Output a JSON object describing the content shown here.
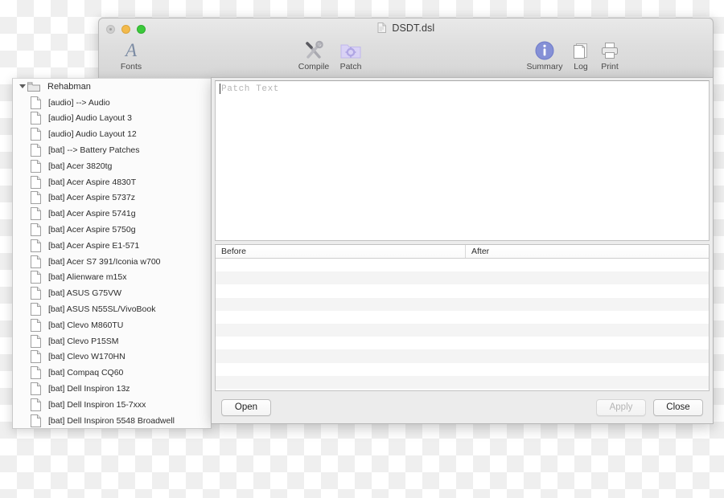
{
  "window": {
    "title": "DSDT.dsl",
    "title_icon": "document-icon",
    "traffic_lights": [
      {
        "name": "close",
        "label": "Close window",
        "color": "#cfcfcf",
        "state": "disabled"
      },
      {
        "name": "minimize",
        "label": "Minimize window",
        "color": "#f3ba4c",
        "state": "enabled"
      },
      {
        "name": "maximize",
        "label": "Maximize window",
        "color": "#3bc93b",
        "state": "enabled"
      }
    ]
  },
  "toolbar": {
    "items": [
      {
        "id": "fonts",
        "label": "Fonts",
        "icon": "letter-a-icon"
      },
      {
        "id": "compile",
        "label": "Compile",
        "icon": "screwdriver-wrench-icon"
      },
      {
        "id": "patch",
        "label": "Patch",
        "icon": "folder-gear-icon",
        "selected": true
      },
      {
        "id": "summary",
        "label": "Summary",
        "icon": "info-circle-icon"
      },
      {
        "id": "log",
        "label": "Log",
        "icon": "pages-icon"
      },
      {
        "id": "print",
        "label": "Print",
        "icon": "printer-icon"
      }
    ]
  },
  "sidebar": {
    "root": {
      "label": "Rehabman",
      "icon": "folder-icon",
      "expanded": true
    },
    "items": [
      {
        "label": "[audio] --> Audio"
      },
      {
        "label": "[audio] Audio Layout 3"
      },
      {
        "label": "[audio] Audio Layout 12"
      },
      {
        "label": "[bat] --> Battery Patches"
      },
      {
        "label": "[bat] Acer 3820tg"
      },
      {
        "label": "[bat] Acer Aspire 4830T"
      },
      {
        "label": "[bat] Acer Aspire 5737z"
      },
      {
        "label": "[bat] Acer Aspire 5741g"
      },
      {
        "label": "[bat] Acer Aspire 5750g"
      },
      {
        "label": "[bat] Acer Aspire E1-571"
      },
      {
        "label": "[bat] Acer S7 391/Iconia w700"
      },
      {
        "label": "[bat] Alienware m15x"
      },
      {
        "label": "[bat] ASUS G75VW"
      },
      {
        "label": "[bat] ASUS N55SL/VivoBook"
      },
      {
        "label": "[bat] Clevo M860TU"
      },
      {
        "label": "[bat] Clevo P15SM"
      },
      {
        "label": "[bat] Clevo W170HN"
      },
      {
        "label": "[bat] Compaq CQ60"
      },
      {
        "label": "[bat] Dell Inspiron 13z"
      },
      {
        "label": "[bat] Dell Inspiron 15-7xxx"
      },
      {
        "label": "[bat] Dell Inspiron 5548 Broadwell"
      }
    ]
  },
  "patch_dialog": {
    "patch_text": {
      "value": "",
      "placeholder": "Patch Text"
    },
    "table": {
      "columns": [
        "Before",
        "After"
      ],
      "rows": [
        {
          "before": "",
          "after": ""
        },
        {
          "before": "",
          "after": ""
        },
        {
          "before": "",
          "after": ""
        },
        {
          "before": "",
          "after": ""
        },
        {
          "before": "",
          "after": ""
        },
        {
          "before": "",
          "after": ""
        },
        {
          "before": "",
          "after": ""
        },
        {
          "before": "",
          "after": ""
        },
        {
          "before": "",
          "after": ""
        },
        {
          "before": "",
          "after": ""
        },
        {
          "before": "",
          "after": ""
        },
        {
          "before": "",
          "after": ""
        }
      ]
    },
    "buttons": {
      "open": "Open",
      "apply": "Apply",
      "close": "Close"
    }
  }
}
